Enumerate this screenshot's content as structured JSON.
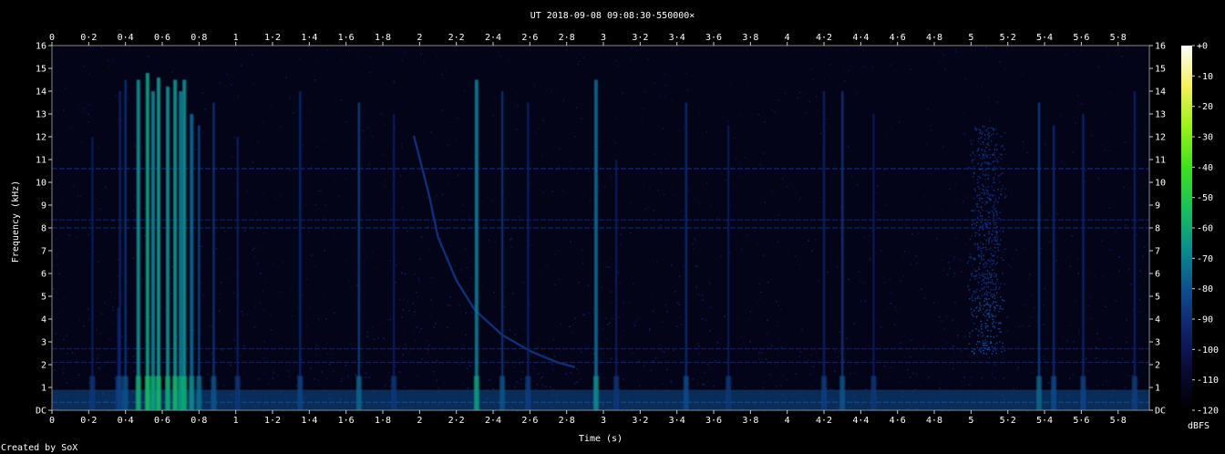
{
  "chart_data": {
    "type": "heatmap",
    "title": "UT 2018-09-08 09:08:30·550000×",
    "xlabel": "Time (s)",
    "ylabel": "Frequency (kHz)",
    "xlim": [
      0,
      5.97
    ],
    "ylim": [
      0,
      16.0
    ],
    "x_ticks": [
      "0",
      "0·2",
      "0·4",
      "0·6",
      "0·8",
      "1",
      "1·2",
      "1·4",
      "1·6",
      "1·8",
      "2",
      "2·2",
      "2·4",
      "2·6",
      "2·8",
      "3",
      "3·2",
      "3·4",
      "3·6",
      "3·8",
      "4",
      "4·2",
      "4·4",
      "4·6",
      "4·8",
      "5",
      "5·2",
      "5·4",
      "5·6",
      "5·8"
    ],
    "y_ticks": [
      "DC",
      "1",
      "2",
      "3",
      "4",
      "5",
      "6",
      "7",
      "8",
      "9",
      "10",
      "11",
      "12",
      "13",
      "14",
      "15",
      "16"
    ],
    "colorbar": {
      "label": "dBFS",
      "range": [
        -120,
        0
      ],
      "ticks": [
        "+0",
        "-10",
        "-20",
        "-30",
        "-40",
        "-50",
        "-60",
        "-70",
        "-80",
        "-90",
        "-100",
        "-110",
        "-120"
      ],
      "colors": [
        "#000000",
        "#0a0a35",
        "#10236b",
        "#0f4f8e",
        "#0b8f8c",
        "#19c25a",
        "#3fe01e",
        "#9af01a",
        "#f5f05a",
        "#ffffff"
      ]
    },
    "background_level_dbfs": -108,
    "low_frequency_band": {
      "fmax_khz": 0.9,
      "level_dbfs": -80
    },
    "horizontal_lines": [
      {
        "freq_khz": 10.6,
        "level_dbfs": -92
      },
      {
        "freq_khz": 8.0,
        "level_dbfs": -94
      },
      {
        "freq_khz": 8.35,
        "level_dbfs": -96
      },
      {
        "freq_khz": 2.7,
        "level_dbfs": -96
      },
      {
        "freq_khz": 2.1,
        "level_dbfs": -96
      },
      {
        "freq_khz": 0.35,
        "level_dbfs": -82
      }
    ],
    "impulses": [
      {
        "t": 0.22,
        "fmax": 12.0,
        "dbfs": -96
      },
      {
        "t": 0.36,
        "fmax": 4.5,
        "dbfs": -96
      },
      {
        "t": 0.37,
        "fmax": 14.0,
        "dbfs": -92
      },
      {
        "t": 0.4,
        "fmax": 14.5,
        "dbfs": -88
      },
      {
        "t": 0.47,
        "fmax": 14.5,
        "dbfs": -68
      },
      {
        "t": 0.52,
        "fmax": 14.8,
        "dbfs": -64
      },
      {
        "t": 0.55,
        "fmax": 14.0,
        "dbfs": -70
      },
      {
        "t": 0.58,
        "fmax": 14.6,
        "dbfs": -66
      },
      {
        "t": 0.63,
        "fmax": 14.2,
        "dbfs": -68
      },
      {
        "t": 0.67,
        "fmax": 14.5,
        "dbfs": -66
      },
      {
        "t": 0.7,
        "fmax": 14.0,
        "dbfs": -72
      },
      {
        "t": 0.72,
        "fmax": 14.5,
        "dbfs": -68
      },
      {
        "t": 0.76,
        "fmax": 13.0,
        "dbfs": -76
      },
      {
        "t": 0.8,
        "fmax": 12.5,
        "dbfs": -82
      },
      {
        "t": 0.88,
        "fmax": 13.5,
        "dbfs": -88
      },
      {
        "t": 1.01,
        "fmax": 12.0,
        "dbfs": -96
      },
      {
        "t": 1.35,
        "fmax": 14.0,
        "dbfs": -92
      },
      {
        "t": 1.67,
        "fmax": 13.5,
        "dbfs": -84
      },
      {
        "t": 1.86,
        "fmax": 13.0,
        "dbfs": -96
      },
      {
        "t": 2.31,
        "fmax": 14.5,
        "dbfs": -72
      },
      {
        "t": 2.45,
        "fmax": 14.0,
        "dbfs": -88
      },
      {
        "t": 2.59,
        "fmax": 13.5,
        "dbfs": -94
      },
      {
        "t": 2.96,
        "fmax": 14.5,
        "dbfs": -76
      },
      {
        "t": 3.07,
        "fmax": 11.0,
        "dbfs": -96
      },
      {
        "t": 3.45,
        "fmax": 13.5,
        "dbfs": -90
      },
      {
        "t": 3.68,
        "fmax": 12.5,
        "dbfs": -96
      },
      {
        "t": 4.2,
        "fmax": 14.0,
        "dbfs": -94
      },
      {
        "t": 4.3,
        "fmax": 14.0,
        "dbfs": -88
      },
      {
        "t": 4.47,
        "fmax": 13.0,
        "dbfs": -96
      },
      {
        "t": 5.37,
        "fmax": 13.5,
        "dbfs": -84
      },
      {
        "t": 5.45,
        "fmax": 12.5,
        "dbfs": -90
      },
      {
        "t": 5.61,
        "fmax": 13.0,
        "dbfs": -92
      },
      {
        "t": 5.89,
        "fmax": 14.0,
        "dbfs": -94
      }
    ],
    "chirp": {
      "points": [
        [
          1.97,
          12.0
        ],
        [
          2.05,
          9.5
        ],
        [
          2.1,
          7.6
        ],
        [
          2.2,
          5.7
        ],
        [
          2.3,
          4.4
        ],
        [
          2.45,
          3.3
        ],
        [
          2.6,
          2.6
        ],
        [
          2.75,
          2.1
        ],
        [
          2.84,
          1.9
        ]
      ],
      "level_dbfs": -90
    },
    "noise_cloud": {
      "t_center": 5.08,
      "t_width": 0.14,
      "fmin": 2.5,
      "fmax": 12.5,
      "level_dbfs": -92
    }
  },
  "footer": {
    "credit": "Created by SoX"
  }
}
